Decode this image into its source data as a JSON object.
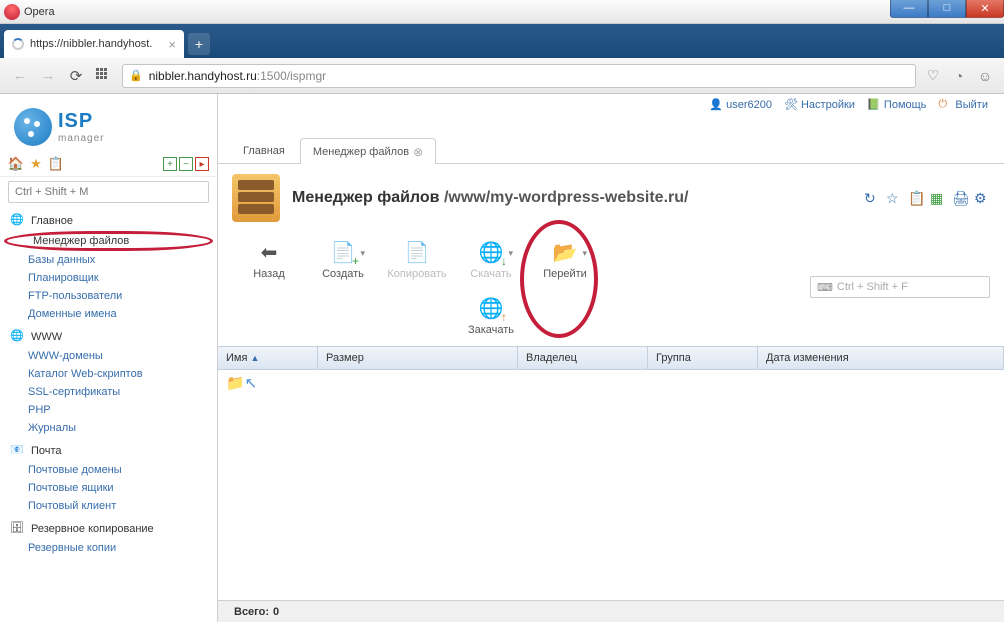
{
  "window": {
    "title": "Opera"
  },
  "browserTab": {
    "label": "https://nibbler.handyhost."
  },
  "url": {
    "domain": "nibbler.handyhost.ru",
    "rest": ":1500/ispmgr"
  },
  "logo": {
    "line1": "ISP",
    "line2": "manager"
  },
  "topmenu": {
    "user": "user6200",
    "settings": "Настройки",
    "help": "Помощь",
    "exit": "Выйти"
  },
  "sidebar": {
    "searchPlaceholder": "Ctrl + Shift + M",
    "sections": [
      {
        "title": "Главное",
        "items": [
          "Менеджер файлов",
          "Базы данных",
          "Планировщик",
          "FTP-пользователи",
          "Доменные имена"
        ]
      },
      {
        "title": "WWW",
        "items": [
          "WWW-домены",
          "Каталог Web-скриптов",
          "SSL-сертификаты",
          "PHP",
          "Журналы"
        ]
      },
      {
        "title": "Почта",
        "items": [
          "Почтовые домены",
          "Почтовые ящики",
          "Почтовый клиент"
        ]
      },
      {
        "title": "Резервное копирование",
        "items": [
          "Резервные копии"
        ]
      }
    ]
  },
  "tabs": {
    "home": "Главная",
    "fm": "Менеджер файлов"
  },
  "page": {
    "title": "Менеджер файлов",
    "path": "/www/my-wordpress-website.ru/"
  },
  "toolbar": {
    "back": "Назад",
    "create": "Создать",
    "copy": "Копировать",
    "download": "Скачать",
    "upload": "Закачать",
    "goto": "Перейти",
    "searchPlaceholder": "Ctrl + Shift + F"
  },
  "grid": {
    "cols": {
      "name": "Имя",
      "size": "Размер",
      "owner": "Владелец",
      "group": "Группа",
      "mtime": "Дата изменения"
    }
  },
  "status": {
    "totalLabel": "Всего:",
    "totalValue": "0"
  }
}
